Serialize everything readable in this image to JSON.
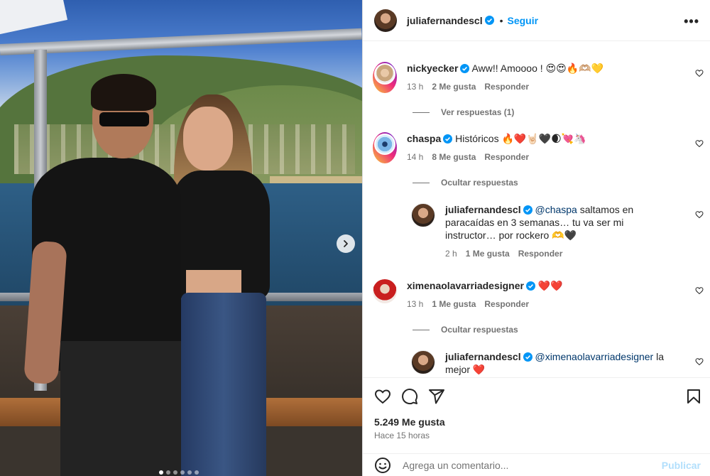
{
  "post": {
    "author": "juliafernandescl",
    "follow_label": "Seguir",
    "separator": "•",
    "more_label": "•••",
    "image_count": 6,
    "active_image": 1
  },
  "comments": [
    {
      "username": "nickyecker",
      "verified": true,
      "text": "Aww!! Amoooo ! 😍😍🔥🫶🏼💛",
      "time": "13 h",
      "likes": "2 Me gusta",
      "reply_label": "Responder",
      "toggle_label": "Ver respuestas (1)"
    },
    {
      "username": "chaspa",
      "verified": true,
      "text": "Históricos 🔥❤️🤘🏻🖤🌒💘🦄",
      "time": "14 h",
      "likes": "8 Me gusta",
      "reply_label": "Responder",
      "toggle_label": "Ocultar respuestas"
    },
    {
      "username": "ximenaolavarriadesigner",
      "verified": true,
      "text": "❤️❤️",
      "time": "13 h",
      "likes": "1 Me gusta",
      "reply_label": "Responder",
      "toggle_label": "Ocultar respuestas"
    }
  ],
  "replies": [
    {
      "username": "juliafernandescl",
      "verified": true,
      "mention": "@chaspa",
      "text": "saltamos en paracaídas en 3 semanas… tu va ser mi instructor… por rockero 🫶🖤",
      "time": "2 h",
      "likes": "1 Me gusta",
      "reply_label": "Responder"
    },
    {
      "username": "juliafernandescl",
      "verified": true,
      "mention": "@ximenaolavarriadesigner",
      "text": "la mejor ❤️"
    }
  ],
  "footer": {
    "likes": "5.249 Me gusta",
    "time_ago": "Hace 15 horas",
    "comment_placeholder": "Agrega un comentario...",
    "publish_label": "Publicar"
  },
  "colors": {
    "accent": "#0095f6",
    "text": "#262626",
    "muted": "#737373",
    "mention": "#00376b",
    "publish_disabled": "#b2dffc"
  },
  "icons": [
    "chevron-right-icon",
    "more-icon",
    "verified-icon",
    "heart-icon",
    "comment-icon",
    "share-icon",
    "bookmark-icon",
    "emoji-icon"
  ]
}
